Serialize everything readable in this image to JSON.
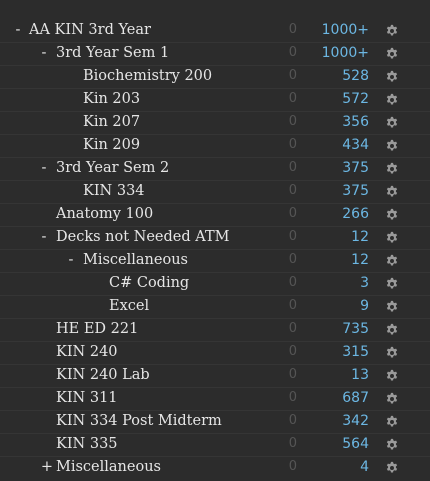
{
  "decks": [
    {
      "toggle": "-",
      "name": "AA KIN 3rd Year",
      "new": "0",
      "due": "1000+",
      "gear_icon": "gear-icon"
    },
    {
      "toggle": "-",
      "name": "3rd Year Sem 1",
      "new": "0",
      "due": "1000+",
      "gear_icon": "gear-icon"
    },
    {
      "toggle": "",
      "name": "Biochemistry 200",
      "new": "0",
      "due": "528",
      "gear_icon": "gear-icon"
    },
    {
      "toggle": "",
      "name": "Kin 203",
      "new": "0",
      "due": "572",
      "gear_icon": "gear-icon"
    },
    {
      "toggle": "",
      "name": "Kin 207",
      "new": "0",
      "due": "356",
      "gear_icon": "gear-icon"
    },
    {
      "toggle": "",
      "name": "Kin 209",
      "new": "0",
      "due": "434",
      "gear_icon": "gear-icon"
    },
    {
      "toggle": "-",
      "name": "3rd Year Sem 2",
      "new": "0",
      "due": "375",
      "gear_icon": "gear-icon"
    },
    {
      "toggle": "",
      "name": "KIN 334",
      "new": "0",
      "due": "375",
      "gear_icon": "gear-icon"
    },
    {
      "toggle": "",
      "name": "Anatomy 100",
      "new": "0",
      "due": "266",
      "gear_icon": "gear-icon"
    },
    {
      "toggle": "-",
      "name": "Decks not Needed ATM",
      "new": "0",
      "due": "12",
      "gear_icon": "gear-icon"
    },
    {
      "toggle": "-",
      "name": "Miscellaneous",
      "new": "0",
      "due": "12",
      "gear_icon": "gear-icon"
    },
    {
      "toggle": "",
      "name": "C# Coding",
      "new": "0",
      "due": "3",
      "gear_icon": "gear-icon"
    },
    {
      "toggle": "",
      "name": "Excel",
      "new": "0",
      "due": "9",
      "gear_icon": "gear-icon"
    },
    {
      "toggle": "",
      "name": "HE ED 221",
      "new": "0",
      "due": "735",
      "gear_icon": "gear-icon"
    },
    {
      "toggle": "",
      "name": "KIN 240",
      "new": "0",
      "due": "315",
      "gear_icon": "gear-icon"
    },
    {
      "toggle": "",
      "name": "KIN 240 Lab",
      "new": "0",
      "due": "13",
      "gear_icon": "gear-icon"
    },
    {
      "toggle": "",
      "name": "KIN 311",
      "new": "0",
      "due": "687",
      "gear_icon": "gear-icon"
    },
    {
      "toggle": "",
      "name": "KIN 334 Post Midterm",
      "new": "0",
      "due": "342",
      "gear_icon": "gear-icon"
    },
    {
      "toggle": "",
      "name": "KIN 335",
      "new": "0",
      "due": "564",
      "gear_icon": "gear-icon"
    },
    {
      "toggle": "+",
      "name": "Miscellaneous",
      "new": "0",
      "due": "4",
      "gear_icon": "gear-icon"
    }
  ],
  "colors": {
    "background": "#2c2c2c",
    "text": "#e6e6e6",
    "new_count": "#555555",
    "due_count": "#6cb7e3",
    "gear": "#9a9a9a"
  }
}
